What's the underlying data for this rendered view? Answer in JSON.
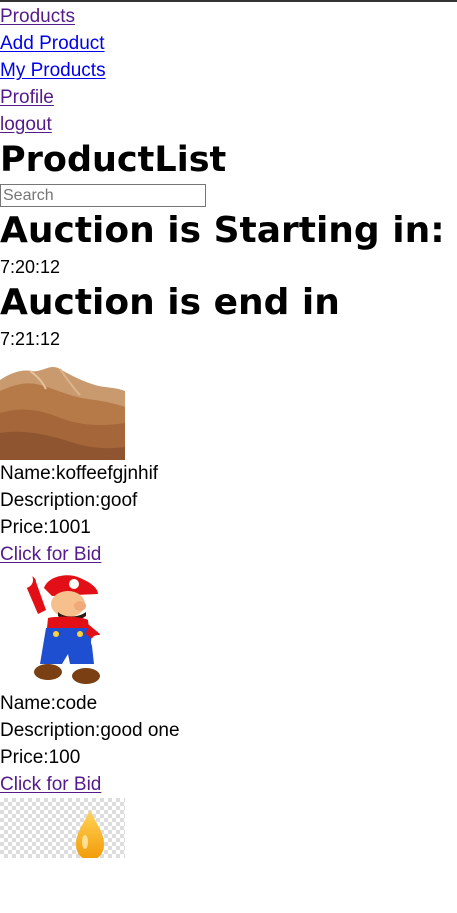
{
  "nav": {
    "products": "Products",
    "add_product": "Add Product",
    "my_products": "My Products",
    "profile": "Profile",
    "logout": "logout"
  },
  "page_title": "ProductList",
  "search": {
    "placeholder": "Search"
  },
  "auction": {
    "start_label": "Auction is Starting in:",
    "start_time": "7:20:12",
    "end_label": "Auction is end in",
    "end_time": "7:21:12"
  },
  "products": [
    {
      "name": "Name:koffeefgjnhif",
      "description": "Description:goof",
      "price": "Price:1001",
      "bid": "Click for Bid",
      "image": "desert-dunes-image"
    },
    {
      "name": "Name:code",
      "description": "Description:good one",
      "price": "Price:100",
      "bid": "Click for Bid",
      "image": "mario-character-image"
    },
    {
      "image": "oil-drop-image"
    }
  ],
  "colors": {
    "visited_link": "#551a8b",
    "unvisited_link": "#0000ee"
  }
}
